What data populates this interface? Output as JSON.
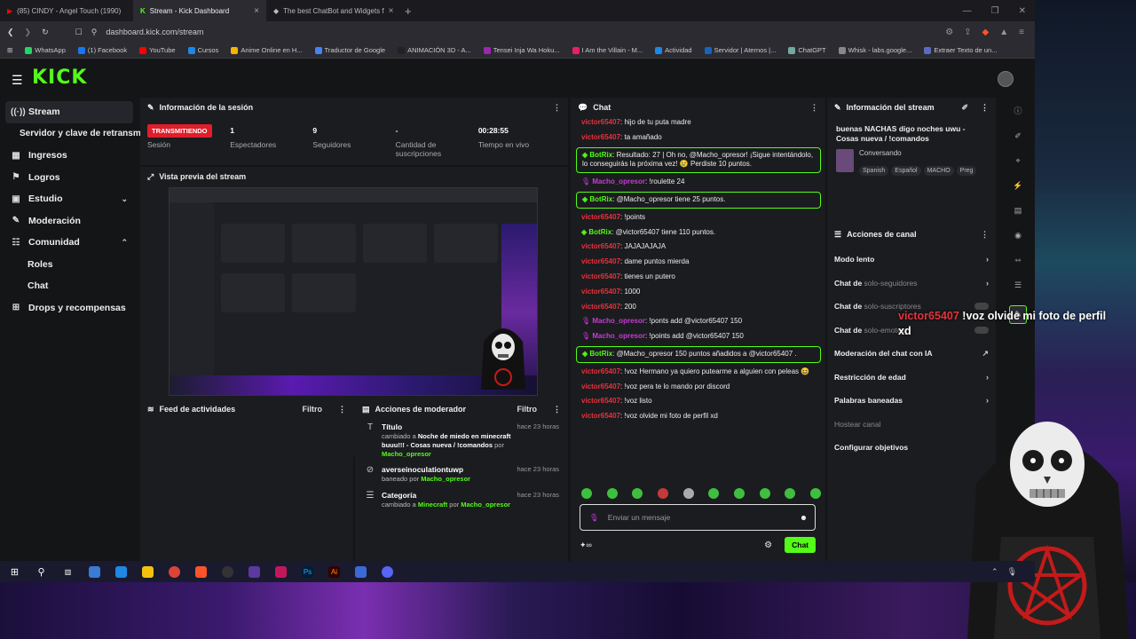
{
  "browser": {
    "tabs": [
      {
        "label": "(85) CINDY - Angel Touch (1990)",
        "active": false
      },
      {
        "label": "Stream - Kick Dashboard",
        "active": true
      },
      {
        "label": "The best ChatBot and Widgets f",
        "active": false
      }
    ],
    "url": "dashboard.kick.com/stream",
    "bookmarks": [
      "WhatsApp",
      "(1) Facebook",
      "YouTube",
      "Cursos",
      "Anime Online en H...",
      "Traductor de Google",
      "ANIMACIÓN 3D - A...",
      "Tensei Inja Wa Hoku...",
      "I Am the Villain - M...",
      "Actividad",
      "Servidor | Aternos |...",
      "ChatGPT",
      "Whisk - labs.google...",
      "Extraer Texto de un..."
    ],
    "bookmark_colors": [
      "#25d366",
      "#1877f2",
      "#ff0000",
      "#1e88e5",
      "#f4b400",
      "#4285f4",
      "#222222",
      "#9c27b0",
      "#e91e63",
      "#1e88e5",
      "#1565c0",
      "#74aa9c",
      "#888888",
      "#5c6bc0"
    ]
  },
  "app": {
    "logo": "KICK",
    "sidebar": [
      {
        "label": "Stream",
        "icon": "broadcast-icon",
        "glyph": "((·))",
        "kind": "active"
      },
      {
        "label": "Servidor y clave de retransm",
        "icon": "",
        "glyph": "",
        "kind": "sub"
      },
      {
        "label": "Ingresos",
        "icon": "revenue-icon",
        "glyph": "▦",
        "kind": "main"
      },
      {
        "label": "Logros",
        "icon": "trophy-icon",
        "glyph": "⚑",
        "kind": "main"
      },
      {
        "label": "Estudio",
        "icon": "studio-icon",
        "glyph": "▣",
        "kind": "main",
        "chev": "⌄"
      },
      {
        "label": "Moderación",
        "icon": "wrench-icon",
        "glyph": "✎",
        "kind": "main"
      },
      {
        "label": "Comunidad",
        "icon": "people-icon",
        "glyph": "☷",
        "kind": "main",
        "chev": "⌃"
      },
      {
        "label": "Roles",
        "icon": "",
        "glyph": "",
        "kind": "sub2"
      },
      {
        "label": "Chat",
        "icon": "",
        "glyph": "",
        "kind": "sub2"
      },
      {
        "label": "Drops y recompensas",
        "icon": "gift-icon",
        "glyph": "⊞",
        "kind": "main"
      }
    ],
    "session": {
      "title": "Información de la sesión",
      "stats": [
        {
          "value": "TRANSMITIENDO",
          "label": "Sesión",
          "badge": true
        },
        {
          "value": "1",
          "label": "Espectadores"
        },
        {
          "value": "9",
          "label": "Seguidores"
        },
        {
          "value": "-",
          "label": "Cantidad de suscripciones"
        },
        {
          "value": "00:28:55",
          "label": "Tiempo en vivo"
        }
      ]
    },
    "preview": {
      "title": "Vista previa del stream"
    },
    "activity": {
      "title": "Feed de actividades",
      "filter": "Filtro"
    },
    "modactions": {
      "title": "Acciones de moderador",
      "filter": "Filtro",
      "items": [
        {
          "icon": "title-icon",
          "glyph": "T",
          "title": "Título",
          "time": "hace 23 horas",
          "pre": "cambiado a ",
          "bold": "Noche de miedo en minecraft buuu!!! - Cosas nueva / !comandos",
          "by": " por ",
          "user": "Macho_opresor"
        },
        {
          "icon": "ban-icon",
          "glyph": "⊘",
          "title": "averseinoculationtuwp",
          "time": "hace 23 horas",
          "pre": "baneado por ",
          "bold": "",
          "by": "",
          "user": "Macho_opresor"
        },
        {
          "icon": "category-icon",
          "glyph": "☰",
          "title": "Categoría",
          "time": "hace 23 horas",
          "pre": "cambiado a ",
          "bold": "",
          "by": "",
          "user": "Minecraft",
          "tail": " por ",
          "user2": "Macho_opresor"
        }
      ]
    },
    "chat": {
      "title": "Chat",
      "messages": [
        {
          "user": "victor65407",
          "type": "u",
          "text": "hijo de tu puta madre"
        },
        {
          "user": "victor65407",
          "type": "u",
          "text": "ta amañado"
        },
        {
          "user": "BotRix",
          "type": "bot",
          "text": "Resultado: 27 | Oh no, @Macho_opresor! ¡Sigue intentándolo, lo conseguirás la próxima vez! 😢 Perdiste 10 puntos."
        },
        {
          "user": "Macho_opresor",
          "type": "m",
          "text": "!roulette 24"
        },
        {
          "user": "BotRix",
          "type": "bot",
          "text": "@Macho_opresor tiene 25 puntos."
        },
        {
          "user": "victor65407",
          "type": "u",
          "text": "!points"
        },
        {
          "user": "BotRix",
          "type": "b",
          "text": "@victor65407 tiene 110 puntos."
        },
        {
          "user": "victor65407",
          "type": "u",
          "text": "JAJAJAJAJA"
        },
        {
          "user": "victor65407",
          "type": "u",
          "text": "dame puntos mierda"
        },
        {
          "user": "victor65407",
          "type": "u",
          "text": "tienes un putero"
        },
        {
          "user": "victor65407",
          "type": "u",
          "text": "1000"
        },
        {
          "user": "victor65407",
          "type": "u",
          "text": "200"
        },
        {
          "user": "Macho_opresor",
          "type": "m",
          "text": "!ponts add @victor65407 150"
        },
        {
          "user": "Macho_opresor",
          "type": "m",
          "text": "!points add @victor65407 150"
        },
        {
          "user": "BotRix",
          "type": "bot",
          "text": "@Macho_opresor 150 puntos añadidos a @victor65407 ."
        },
        {
          "user": "victor65407",
          "type": "u",
          "text": "!voz Hermano ya quiero putearme a alguien con peleas 😆"
        },
        {
          "user": "victor65407",
          "type": "u",
          "text": "!voz pera te lo mando por discord"
        },
        {
          "user": "victor65407",
          "type": "u",
          "text": "!voz listo"
        },
        {
          "user": "victor65407",
          "type": "u",
          "text": "!voz olvide mi foto de perfil xd"
        }
      ],
      "placeholder": "Enviar un mensaje",
      "send": "Chat"
    },
    "streaminfo": {
      "title": "Información del stream",
      "stream_title": "buenas NACHAS digo noches uwu - Cosas nueva / !comandos",
      "category": "Conversando",
      "tags": [
        "Spanish",
        "Español",
        "MACHO",
        "Preg"
      ]
    },
    "channelactions": {
      "title": "Acciones de canal",
      "rows": [
        {
          "label": "Modo lento",
          "muted": "",
          "control": "chev"
        },
        {
          "label": "Chat de ",
          "muted": "solo-seguidores",
          "control": "chev"
        },
        {
          "label": "Chat de ",
          "muted": "solo-suscriptores",
          "control": "toggle"
        },
        {
          "label": "Chat de ",
          "muted": "solo-emotes",
          "control": "toggle"
        },
        {
          "label": "Moderación del chat con IA",
          "muted": "",
          "control": "ext"
        },
        {
          "label": "Restricción de edad",
          "muted": "",
          "control": "chev"
        },
        {
          "label": "Palabras baneadas",
          "muted": "",
          "control": "chev"
        },
        {
          "label": "",
          "muted": "Hostear canal",
          "control": ""
        },
        {
          "label": "Configurar objetivos",
          "muted": "",
          "control": ""
        }
      ]
    }
  },
  "overlay": {
    "user": "victor65407",
    "text": "!voz olvide mi foto de perfil xd"
  },
  "colors": {
    "kick_green": "#53fc18",
    "live_red": "#e01e2a",
    "user_red": "#e8313b",
    "mod_purple": "#c73bd8"
  }
}
